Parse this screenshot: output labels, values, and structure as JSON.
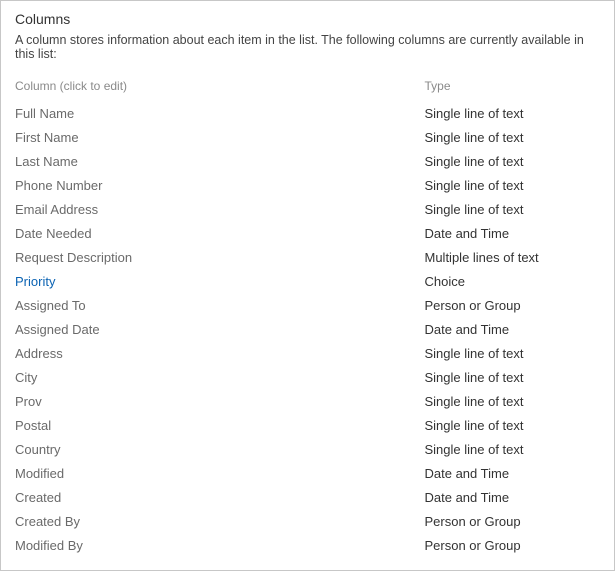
{
  "section": {
    "title": "Columns",
    "description": "A column stores information about each item in the list. The following columns are currently available in this list:"
  },
  "headers": {
    "column": "Column (click to edit)",
    "type": "Type"
  },
  "columns": [
    {
      "name": "Full Name",
      "type": "Single line of text",
      "highlight": false
    },
    {
      "name": "First Name",
      "type": "Single line of text",
      "highlight": false
    },
    {
      "name": "Last Name",
      "type": "Single line of text",
      "highlight": false
    },
    {
      "name": "Phone Number",
      "type": "Single line of text",
      "highlight": false
    },
    {
      "name": "Email Address",
      "type": "Single line of text",
      "highlight": false
    },
    {
      "name": "Date Needed",
      "type": "Date and Time",
      "highlight": false
    },
    {
      "name": "Request Description",
      "type": "Multiple lines of text",
      "highlight": false
    },
    {
      "name": "Priority",
      "type": "Choice",
      "highlight": true
    },
    {
      "name": "Assigned To",
      "type": "Person or Group",
      "highlight": false
    },
    {
      "name": "Assigned Date",
      "type": "Date and Time",
      "highlight": false
    },
    {
      "name": "Address",
      "type": "Single line of text",
      "highlight": false
    },
    {
      "name": "City",
      "type": "Single line of text",
      "highlight": false
    },
    {
      "name": "Prov",
      "type": "Single line of text",
      "highlight": false
    },
    {
      "name": "Postal",
      "type": "Single line of text",
      "highlight": false
    },
    {
      "name": "Country",
      "type": "Single line of text",
      "highlight": false
    },
    {
      "name": "Modified",
      "type": "Date and Time",
      "highlight": false
    },
    {
      "name": "Created",
      "type": "Date and Time",
      "highlight": false
    },
    {
      "name": "Created By",
      "type": "Person or Group",
      "highlight": false
    },
    {
      "name": "Modified By",
      "type": "Person or Group",
      "highlight": false
    }
  ]
}
